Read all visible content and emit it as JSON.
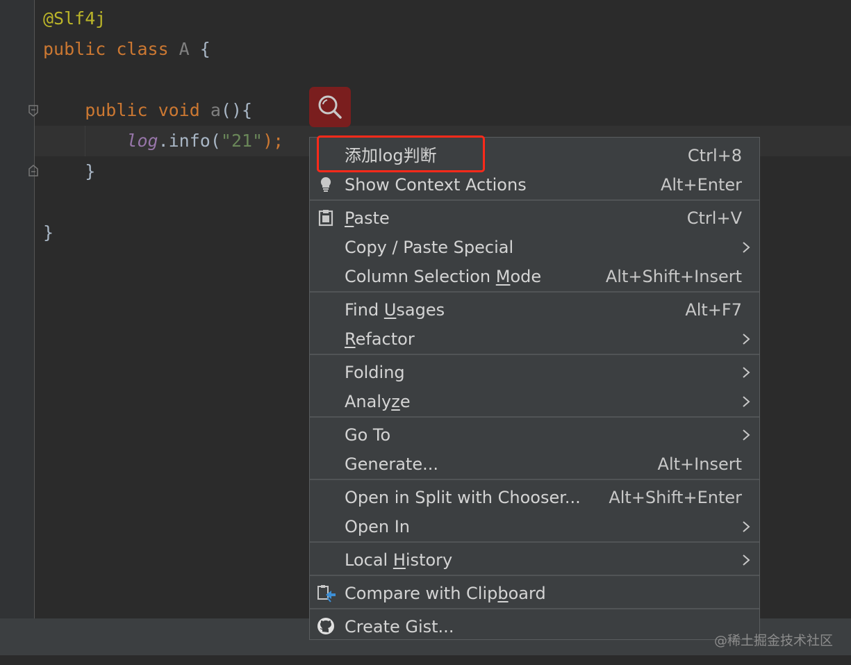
{
  "editor": {
    "lines": [
      {
        "tokens": [
          {
            "t": "@Slf4j",
            "c": "ann"
          }
        ]
      },
      {
        "tokens": [
          {
            "t": "public ",
            "c": "kw"
          },
          {
            "t": "class ",
            "c": "kw"
          },
          {
            "t": "A ",
            "c": "cls"
          },
          {
            "t": "{",
            "c": "plain"
          }
        ]
      },
      {
        "tokens": [
          {
            "t": "    public ",
            "c": "kw"
          },
          {
            "t": "void ",
            "c": "kw"
          },
          {
            "t": "a",
            "c": "cls"
          },
          {
            "t": "(){",
            "c": "plain"
          }
        ]
      },
      {
        "tokens": [
          {
            "t": "        ",
            "c": "plain"
          },
          {
            "t": "log",
            "c": "field"
          },
          {
            "t": ".info(",
            "c": "plain"
          },
          {
            "t": "\"21\"",
            "c": "str"
          },
          {
            "t": ");",
            "c": "kw"
          }
        ]
      },
      {
        "tokens": [
          {
            "t": "    }",
            "c": "plain"
          }
        ]
      },
      {
        "tokens": [
          {
            "t": "}",
            "c": "plain"
          }
        ]
      }
    ],
    "search_icon": "search-icon"
  },
  "menu": {
    "items": [
      {
        "label": "添加log判断",
        "shortcut": "Ctrl+8",
        "mnemonic": ""
      },
      {
        "label": "Show Context Actions",
        "shortcut": "Alt+Enter",
        "icon": "lightbulb-icon"
      },
      {
        "label": "Paste",
        "mnemonic_prefix": "",
        "mnemonic_char": "P",
        "mnemonic_rest": "aste",
        "shortcut": "Ctrl+V",
        "icon": "clipboard-icon"
      },
      {
        "label": "Copy / Paste Special",
        "shortcut": "",
        "submenu": true
      },
      {
        "label": "Column Selection Mode",
        "mnemonic_prefix": "Column Selection ",
        "mnemonic_char": "M",
        "mnemonic_rest": "ode",
        "shortcut": "Alt+Shift+Insert"
      },
      {
        "label": "Find Usages",
        "mnemonic_prefix": "Find ",
        "mnemonic_char": "U",
        "mnemonic_rest": "sages",
        "shortcut": "Alt+F7"
      },
      {
        "label": "Refactor",
        "mnemonic_prefix": "",
        "mnemonic_char": "R",
        "mnemonic_rest": "efactor",
        "submenu": true
      },
      {
        "label": "Folding",
        "submenu": true
      },
      {
        "label": "Analyze",
        "mnemonic_prefix": "Analy",
        "mnemonic_char": "z",
        "mnemonic_rest": "e",
        "submenu": true
      },
      {
        "label": "Go To",
        "submenu": true
      },
      {
        "label": "Generate...",
        "shortcut": "Alt+Insert"
      },
      {
        "label": "Open in Split with Chooser...",
        "shortcut": "Alt+Shift+Enter"
      },
      {
        "label": "Open In",
        "submenu": true
      },
      {
        "label": "Local History",
        "mnemonic_prefix": "Local ",
        "mnemonic_char": "H",
        "mnemonic_rest": "istory",
        "submenu": true
      },
      {
        "label": "Compare with Clipboard",
        "mnemonic_prefix": "Compare with Clip",
        "mnemonic_char": "b",
        "mnemonic_rest": "oard",
        "icon": "compare-icon"
      },
      {
        "label": "Create Gist...",
        "icon": "github-icon"
      }
    ]
  },
  "watermark": "@稀土掘金技术社区",
  "colors": {
    "background": "#2b2b2b",
    "menu_background": "#3c3f41",
    "highlight_border": "#ff2a1a",
    "search_button": "#7a1e1e"
  }
}
